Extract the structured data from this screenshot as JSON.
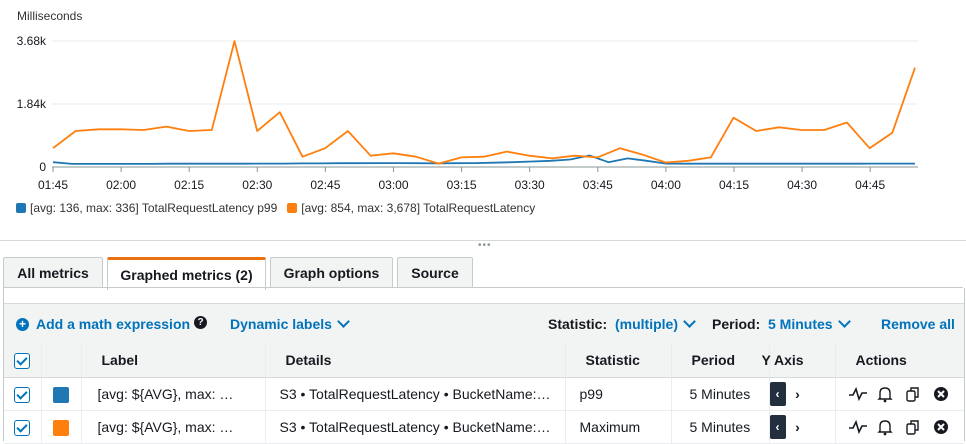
{
  "chart_data": {
    "type": "line",
    "ylabel": "Milliseconds",
    "y_ticks": [
      "3.68k",
      "1.84k",
      "0"
    ],
    "y_tick_values": [
      3680,
      1840,
      0
    ],
    "ylim": [
      0,
      3680
    ],
    "x_ticks": [
      "01:45",
      "02:00",
      "02:15",
      "02:30",
      "02:45",
      "03:00",
      "03:15",
      "03:30",
      "03:45",
      "04:00",
      "04:15",
      "04:30",
      "04:45"
    ],
    "grid": true,
    "series": [
      {
        "name": "[avg: 136, max: 336] TotalRequestLatency p99",
        "color": "#1f77b4",
        "values": [
          140,
          90,
          90,
          90,
          90,
          90,
          95,
          95,
          95,
          95,
          95,
          100,
          100,
          105,
          105,
          110,
          110,
          115,
          115,
          110,
          105,
          110,
          115,
          125,
          140,
          160,
          180,
          220,
          336,
          140,
          250,
          180,
          100,
          95,
          95,
          95,
          95,
          95,
          95,
          95,
          95,
          95,
          95,
          100,
          100,
          100
        ]
      },
      {
        "name": "[avg: 854, max: 854, max: 3,678] TotalRequestLatency",
        "legend_name": "[avg: 854, max: 3,678] TotalRequestLatency",
        "color": "#ff7f0e",
        "values": [
          550,
          1050,
          1100,
          1100,
          1080,
          1180,
          1050,
          1080,
          3678,
          1050,
          1600,
          300,
          550,
          1050,
          330,
          400,
          300,
          100,
          280,
          300,
          450,
          330,
          250,
          330,
          280,
          550,
          360,
          130,
          180,
          280,
          1440,
          1050,
          1160,
          1080,
          1080,
          1300,
          550,
          1000,
          2900
        ]
      }
    ]
  },
  "tabs": [
    {
      "label": "All metrics"
    },
    {
      "label": "Graphed metrics (2)"
    },
    {
      "label": "Graph options"
    },
    {
      "label": "Source"
    }
  ],
  "toolbar": {
    "add_math": "Add a math expression",
    "help_icon": "?",
    "dynamic_labels": "Dynamic labels",
    "statistic_label": "Statistic:",
    "statistic_value": "(multiple)",
    "period_label": "Period:",
    "period_value": "5 Minutes",
    "remove_all": "Remove all"
  },
  "table": {
    "headers": {
      "label": "Label",
      "details": "Details",
      "statistic": "Statistic",
      "period": "Period",
      "yaxis": "Y Axis",
      "actions": "Actions"
    },
    "rows": [
      {
        "color": "#1f77b4",
        "label": "[avg: ${AVG}, max: …",
        "details": "S3 • TotalRequestLatency • BucketName:…",
        "statistic": "p99",
        "period": "5 Minutes",
        "yaxis_left": "‹",
        "yaxis_right": "›",
        "checked": true
      },
      {
        "color": "#ff7f0e",
        "label": "[avg: ${AVG}, max: …",
        "details": "S3 • TotalRequestLatency • BucketName:…",
        "statistic": "Maximum",
        "period": "5 Minutes",
        "yaxis_left": "‹",
        "yaxis_right": "›",
        "checked": true
      }
    ]
  }
}
